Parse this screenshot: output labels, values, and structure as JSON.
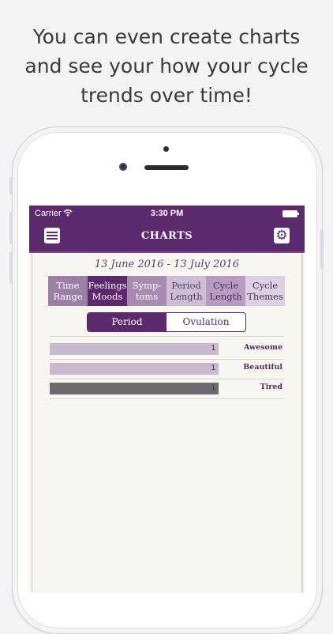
{
  "headline": {
    "line1": "You can even create charts",
    "line2": "and see your how your cycle",
    "line3": "trends over time!"
  },
  "status_bar": {
    "carrier": "Carrier",
    "wifi_icon": "wifi-icon",
    "time": "3:30 PM",
    "battery_icon": "battery-icon"
  },
  "nav": {
    "title": "CHARTS",
    "menu_icon": "hamburger-menu-icon",
    "settings_icon": "gear-icon"
  },
  "date_range": "13 June 2016 - 13 July 2016",
  "tabs": [
    {
      "label": "Time\nRange"
    },
    {
      "label": "Feelings\nMoods",
      "selected": true
    },
    {
      "label": "Symp-\ntoms"
    },
    {
      "label": "Period\nLength"
    },
    {
      "label": "Cycle\nLength"
    },
    {
      "label": "Cycle\nThemes"
    }
  ],
  "segment": {
    "period": "Period",
    "ovulation": "Ovulation",
    "selected": "Period"
  },
  "chart_data": {
    "type": "bar",
    "categories": [
      "Awesome",
      "Beautiful",
      "Tired"
    ],
    "values": [
      1,
      1,
      1
    ],
    "colors": [
      "#c9b9cf",
      "#c9b9cf",
      "#6f6a70"
    ]
  },
  "colors": {
    "brand": "#5c2a6c",
    "paper": "#f8f6f1"
  }
}
